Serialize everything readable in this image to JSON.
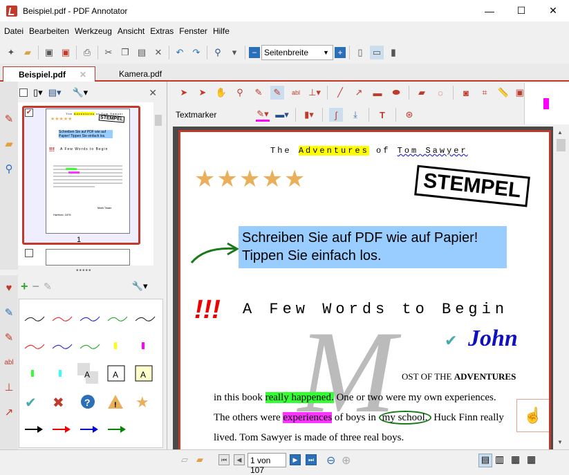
{
  "window": {
    "title": "Beispiel.pdf - PDF Annotator",
    "minimize": "—",
    "maximize": "☐",
    "close": "✕"
  },
  "menu": [
    "Datei",
    "Bearbeiten",
    "Werkzeug",
    "Ansicht",
    "Extras",
    "Fenster",
    "Hilfe"
  ],
  "toolbar": {
    "zoom_value": "Seitenbreite"
  },
  "tabs": [
    {
      "label": "Beispiel.pdf"
    },
    {
      "label": "Kamera.pdf"
    }
  ],
  "annotation_toolbar": {
    "mode_label": "Textmarker"
  },
  "thumbnail": {
    "page_number": "1",
    "mini_title_1": "The",
    "mini_title_2": "Adventures",
    "mini_title_3": "of Tom Sawyer",
    "mini_stamp": "STEMPEL",
    "mini_box": "Schreiben Sie auf PDF wie auf Papier! Tippen Sie einfach los.",
    "mini_heading": "A Few Words to Begin",
    "mini_author": "Mark Twain",
    "mini_place": "Hartford, 1876"
  },
  "document": {
    "title_the": "The",
    "title_adventures": "Adventures",
    "title_of": "of",
    "title_tom_sawyer": "Tom Sawyer",
    "stamp": "STEMPEL",
    "note_line1": "Schreiben Sie auf PDF wie auf Papier!",
    "note_line2": "Tippen Sie einfach los.",
    "exclaim": "!!!",
    "heading": "A Few Words to Begin",
    "signature": "John",
    "dropcap_rest_1": "OST OF THE ",
    "dropcap_rest_2": "ADVENTURES",
    "line1_a": "in this book ",
    "line1_b": "really happened.",
    "line1_c": " One or two were my own experiences.",
    "line2_a": "The others were ",
    "line2_b": "experiences",
    "line2_c": " of boys in ",
    "line2_d": "my school.",
    "line2_e": " Huck Finn really",
    "line3": "lived. Tom Sawyer is made of three real boys."
  },
  "status": {
    "page_input": "1 von 107"
  },
  "colors": {
    "accent": "#c0392b",
    "highlight_yellow": "#ffff00",
    "highlight_green": "#33ff33",
    "highlight_magenta": "#ff33ff",
    "note_blue": "#99ccff",
    "star": "#e8b05a"
  }
}
